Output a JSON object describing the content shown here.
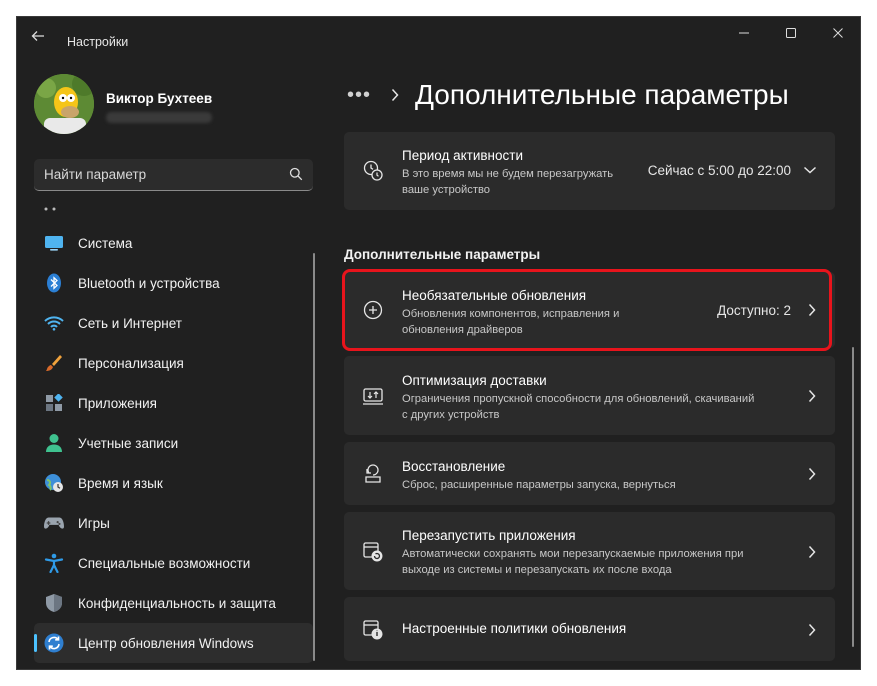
{
  "window": {
    "app_title": "Настройки",
    "accent_color": "#4cc2ff",
    "highlight_color": "#e8141c"
  },
  "user": {
    "name": "Виктор Бухтеев"
  },
  "search": {
    "placeholder": "Найти параметр",
    "icon": "search-icon"
  },
  "sidebar": {
    "items": [
      {
        "label": "Система",
        "icon": "monitor-icon"
      },
      {
        "label": "Bluetooth и устройства",
        "icon": "bluetooth-icon"
      },
      {
        "label": "Сеть и Интернет",
        "icon": "wifi-icon"
      },
      {
        "label": "Персонализация",
        "icon": "brush-icon"
      },
      {
        "label": "Приложения",
        "icon": "apps-icon"
      },
      {
        "label": "Учетные записи",
        "icon": "person-icon"
      },
      {
        "label": "Время и язык",
        "icon": "globe-clock-icon"
      },
      {
        "label": "Игры",
        "icon": "gamepad-icon"
      },
      {
        "label": "Специальные возможности",
        "icon": "accessibility-icon"
      },
      {
        "label": "Конфиденциальность и защита",
        "icon": "shield-icon"
      },
      {
        "label": "Центр обновления Windows",
        "icon": "update-icon",
        "active": true
      }
    ]
  },
  "header": {
    "breadcrumb_dots": "•••",
    "title": "Дополнительные параметры"
  },
  "main": {
    "active_hours": {
      "title": "Период активности",
      "subtitle_line1": "В это время мы не будем перезагружать",
      "subtitle_line2": "ваше устройство",
      "value": "Сейчас с 5:00 до 22:00",
      "icon": "active-hours-icon"
    },
    "section_title": "Дополнительные параметры",
    "cards": [
      {
        "title": "Необязательные обновления",
        "subtitle_line1": "Обновления компонентов, исправления и",
        "subtitle_line2": "обновления драйверов",
        "value": "Доступно: 2",
        "icon": "plus-circle-icon"
      },
      {
        "title": "Оптимизация доставки",
        "subtitle_line1": "Ограничения пропускной способности для обновлений, скачиваний",
        "subtitle_line2": "с других устройств",
        "icon": "delivery-optimization-icon"
      },
      {
        "title": "Восстановление",
        "subtitle_line1": "Сброс, расширенные параметры запуска, вернуться",
        "icon": "recovery-icon"
      },
      {
        "title": "Перезапустить приложения",
        "subtitle_line1": "Автоматически сохранять мои перезапускаемые приложения при",
        "subtitle_line2": "выходе из системы и перезапускать их после входа",
        "icon": "restart-apps-icon"
      },
      {
        "title": "Настроенные политики обновления",
        "icon": "policy-icon"
      }
    ]
  }
}
